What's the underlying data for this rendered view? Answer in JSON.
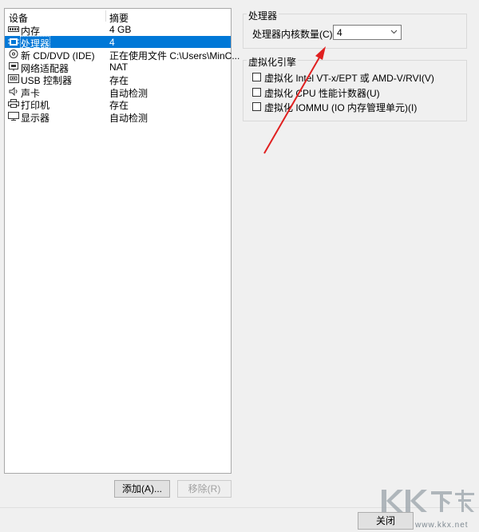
{
  "device_list": {
    "header": {
      "device": "设备",
      "summary": "摘要"
    },
    "rows": [
      {
        "name": "内存",
        "summary": "4 GB",
        "icon": "memory-icon"
      },
      {
        "name": "处理器",
        "summary": "4",
        "icon": "processor-icon"
      },
      {
        "name": "新 CD/DVD (IDE)",
        "summary": "正在使用文件 C:\\Users\\MinC...",
        "icon": "cd-dvd-icon"
      },
      {
        "name": "网络适配器",
        "summary": "NAT",
        "icon": "network-adapter-icon"
      },
      {
        "name": "USB 控制器",
        "summary": "存在",
        "icon": "usb-controller-icon"
      },
      {
        "name": "声卡",
        "summary": "自动检测",
        "icon": "sound-card-icon"
      },
      {
        "name": "打印机",
        "summary": "存在",
        "icon": "printer-icon"
      },
      {
        "name": "显示器",
        "summary": "自动检测",
        "icon": "display-icon"
      }
    ],
    "selected": "处理器"
  },
  "buttons": {
    "add": "添加(A)...",
    "remove": "移除(R)",
    "close": "关闭"
  },
  "processor_group": {
    "title": "处理器",
    "core_count_label": "处理器内核数量(C):",
    "core_count_value": "4"
  },
  "virtualization_group": {
    "title": "虚拟化引擎",
    "options": [
      {
        "label": "虚拟化 Intel VT-x/EPT 或 AMD-V/RVI(V)",
        "checked": false
      },
      {
        "label": "虚拟化 CPU 性能计数器(U)",
        "checked": false
      },
      {
        "label": "虚拟化 IOMMU (IO 内存管理单元)(I)",
        "checked": false
      }
    ]
  },
  "annotation": {
    "color": "#e02020"
  },
  "watermark": {
    "logo": "KK下载",
    "url": "www.kkx.net"
  }
}
